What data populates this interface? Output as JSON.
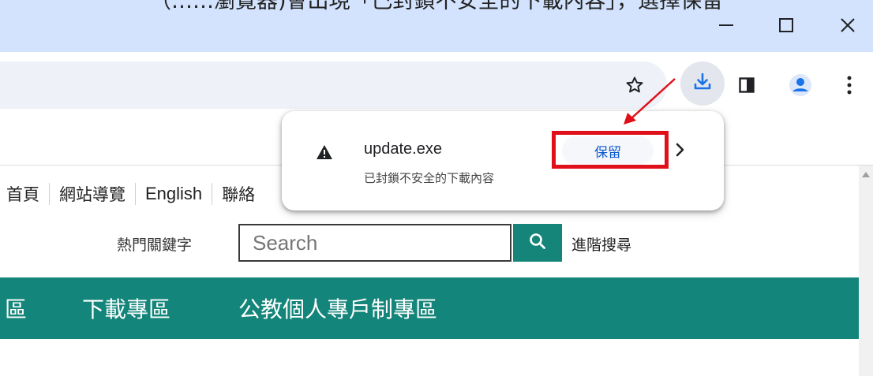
{
  "caption": "（……瀏覽器)會出現「已封鎖不安全的下載內容」，選擇保留",
  "window": {
    "minimize_icon": "minimize-icon",
    "maximize_icon": "maximize-icon",
    "close_icon": "close-icon"
  },
  "toolbar": {
    "icons": [
      "star-icon",
      "download-icon",
      "side-panel-icon",
      "profile-icon",
      "more-vert-icon"
    ]
  },
  "download_popup": {
    "filename": "update.exe",
    "status": "已封鎖不安全的下載內容",
    "keep_label": "保留"
  },
  "page": {
    "topnav": [
      "首頁",
      "網站導覽",
      "English",
      "聯絡"
    ],
    "hot_keywords_label": "熱門關鍵字",
    "search_placeholder": "Search",
    "advanced_search": "進階搜尋",
    "main_nav": [
      "區",
      "下載專區",
      "公教個人專戶制專區"
    ]
  },
  "colors": {
    "titlebar": "#d3e3fd",
    "nav_green": "#14857a",
    "highlight_red": "#e0101b",
    "accent_blue": "#1a73e8"
  }
}
